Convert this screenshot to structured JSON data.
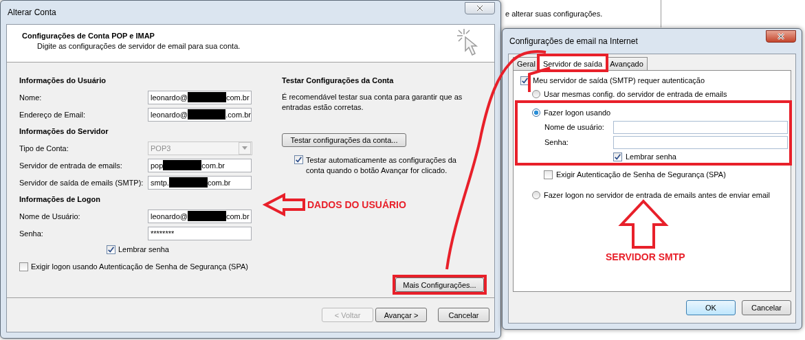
{
  "background_window": {
    "text": "e alterar suas configurações."
  },
  "account_dialog": {
    "title": "Alterar Conta",
    "heading": "Configurações de Conta POP e IMAP",
    "subtitle": "Digite as configurações de servidor de email para sua conta.",
    "sections": [
      {
        "title": "Informações do Usuário",
        "fields": [
          {
            "label": "Nome:",
            "kind": "text",
            "value_start": "leonardo@",
            "redacted": true,
            "value_end": "com.br"
          },
          {
            "label": "Endereço de Email:",
            "kind": "text",
            "value_start": "leonardo@",
            "redacted": true,
            "value_end": ".com.br"
          }
        ]
      },
      {
        "title": "Informações do Servidor",
        "fields": [
          {
            "label": "Tipo de Conta:",
            "kind": "select",
            "value_start": "POP3",
            "disabled": true
          },
          {
            "label": "Servidor de entrada de emails:",
            "kind": "text",
            "value_start": "pop",
            "redacted": true,
            "value_end": "com.br"
          },
          {
            "label": "Servidor de saída de emails (SMTP):",
            "kind": "text",
            "value_start": "smtp.",
            "redacted": true,
            "value_end": "com.br"
          }
        ]
      },
      {
        "title": "Informações de Logon",
        "fields": [
          {
            "label": "Nome de Usuário:",
            "kind": "text",
            "value_start": "leonardo@",
            "redacted": true,
            "value_end": "com.br"
          },
          {
            "label": "Senha:",
            "kind": "text",
            "value_start": "********"
          }
        ]
      }
    ],
    "remember_password": {
      "label": "Lembrar senha",
      "checked": true
    },
    "spa": {
      "label": "Exigir logon usando Autenticação de Senha de Segurança (SPA)",
      "checked": false
    },
    "test_heading": "Testar Configurações da Conta",
    "test_text": "É recomendável testar sua conta para garantir que as entradas estão corretas.",
    "test_button": "Testar configurações da conta...",
    "auto_test": {
      "label": "Testar automaticamente as configurações da conta quando o botão Avançar for clicado.",
      "checked": true
    },
    "more_button": {
      "label": "Mais Configurações...",
      "highlighted": true
    },
    "buttons": [
      {
        "label": "< Voltar",
        "disabled": true
      },
      {
        "label": "Avançar >",
        "disabled": false
      },
      {
        "label": "Cancelar",
        "disabled": false
      }
    ]
  },
  "internet_dialog": {
    "title": "Configurações de email na Internet",
    "tabs": [
      {
        "label": "Geral",
        "selected": false,
        "highlighted": false
      },
      {
        "label": "Servidor de saída",
        "selected": true,
        "highlighted": true
      },
      {
        "label": "Avançado",
        "selected": false,
        "highlighted": false
      }
    ],
    "require_auth": {
      "label": "Meu servidor de saída (SMTP) requer autenticação",
      "checked": true
    },
    "logon_options": [
      {
        "label": "Usar mesmas config. do servidor de entrada de emails",
        "selected": false
      },
      {
        "label": "Fazer logon usando",
        "selected": true,
        "highlighted": true,
        "fields": [
          {
            "label": "Nome de usuário:"
          },
          {
            "label": "Senha:"
          }
        ],
        "remember": {
          "label": "Lembrar senha",
          "checked": true
        },
        "spa": {
          "label": "Exigir Autenticação de Senha de Segurança (SPA)",
          "checked": false
        }
      },
      {
        "label": "Fazer logon no servidor de entrada de emails antes de enviar email",
        "selected": false
      }
    ],
    "buttons": [
      {
        "label": "OK",
        "kind": "default"
      },
      {
        "label": "Cancelar",
        "kind": "normal"
      }
    ]
  },
  "annotations": {
    "labels": [
      {
        "text": "DADOS DO USUÁRIO"
      },
      {
        "text": "SERVIDOR SMTP"
      }
    ]
  }
}
